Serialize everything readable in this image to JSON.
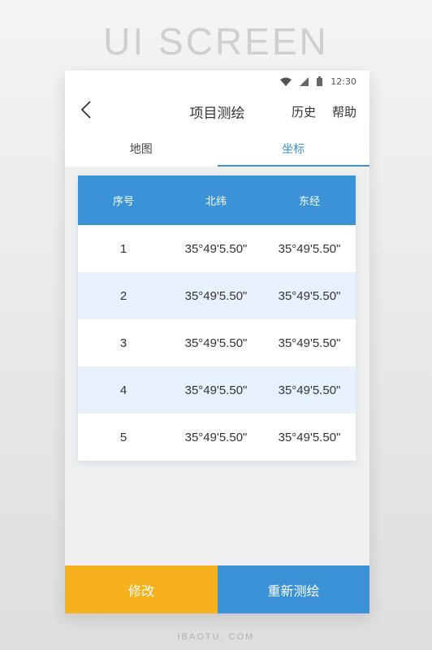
{
  "page_header": "UI SCREEN",
  "page_footer": "IBAOTU. COM",
  "status_bar": {
    "time": "12:30",
    "icons": [
      "wifi-icon",
      "signal-icon",
      "battery-icon"
    ]
  },
  "nav": {
    "back_icon": "chevron-left-icon",
    "title": "项目测绘",
    "history_label": "历史",
    "help_label": "帮助"
  },
  "tabs": [
    {
      "label": "地图",
      "active": false
    },
    {
      "label": "坐标",
      "active": true
    }
  ],
  "table": {
    "headers": [
      "序号",
      "北纬",
      "东经"
    ],
    "rows": [
      {
        "seq": "1",
        "lat": "35°49'5.50\"",
        "lon": "35°49'5.50\""
      },
      {
        "seq": "2",
        "lat": "35°49'5.50\"",
        "lon": "35°49'5.50\""
      },
      {
        "seq": "3",
        "lat": "35°49'5.50\"",
        "lon": "35°49'5.50\""
      },
      {
        "seq": "4",
        "lat": "35°49'5.50\"",
        "lon": "35°49'5.50\""
      },
      {
        "seq": "5",
        "lat": "35°49'5.50\"",
        "lon": "35°49'5.50\""
      }
    ]
  },
  "actions": {
    "edit_label": "修改",
    "remeasure_label": "重新测绘"
  },
  "colors": {
    "accent_blue": "#3a93d6",
    "accent_yellow": "#f7b11c",
    "row_alt": "#e6f1fb"
  }
}
